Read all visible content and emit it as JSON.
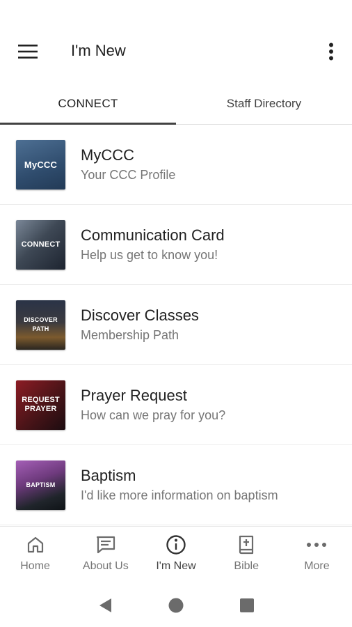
{
  "appbar": {
    "title": "I'm New",
    "menu_icon": "hamburger-menu-icon",
    "overflow_icon": "more-vertical-icon"
  },
  "tabs": [
    {
      "label": "CONNECT",
      "active": true
    },
    {
      "label": "Staff Directory",
      "active": false
    }
  ],
  "items": [
    {
      "title": "MyCCC",
      "subtitle": "Your CCC Profile",
      "thumb_text": "MyCCC"
    },
    {
      "title": "Communication Card",
      "subtitle": "Help us get to know you!",
      "thumb_text": "CONNECT"
    },
    {
      "title": "Discover Classes",
      "subtitle": "Membership Path",
      "thumb_text": "DISCOVER PATH"
    },
    {
      "title": "Prayer Request",
      "subtitle": "How can we pray for you?",
      "thumb_text": "REQUEST PRAYER"
    },
    {
      "title": "Baptism",
      "subtitle": "I'd like more information on baptism",
      "thumb_text": "BAPTISM"
    }
  ],
  "bottom_nav": [
    {
      "label": "Home",
      "icon": "home-icon",
      "active": false
    },
    {
      "label": "About Us",
      "icon": "message-square-icon",
      "active": false
    },
    {
      "label": "I'm New",
      "icon": "info-circle-icon",
      "active": true
    },
    {
      "label": "Bible",
      "icon": "bible-icon",
      "active": false
    },
    {
      "label": "More",
      "icon": "more-horizontal-icon",
      "active": false
    }
  ],
  "colors": {
    "text_primary": "#212121",
    "text_secondary": "#757575",
    "tab_indicator": "#424242",
    "system_nav": "#6b6b6b"
  }
}
